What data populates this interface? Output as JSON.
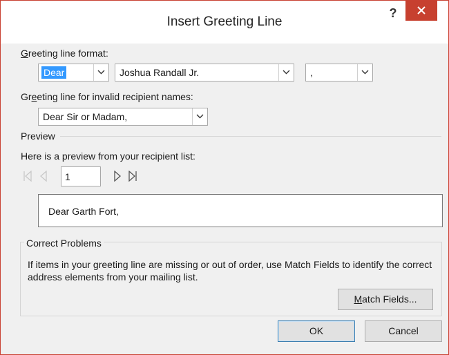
{
  "window": {
    "title": "Insert Greeting Line",
    "help_label": "?"
  },
  "greeting_format": {
    "label_prefix": "G",
    "label_rest": "reeting line format:",
    "salutation": "Dear",
    "name_format": "Joshua Randall Jr.",
    "punctuation": ","
  },
  "invalid_names": {
    "label_prefix": "Gr",
    "label_underlined": "e",
    "label_rest": "eting line for invalid recipient names:",
    "value": "Dear Sir or Madam,"
  },
  "preview": {
    "section_label": "Preview",
    "description": "Here is a preview from your recipient list:",
    "record_number": "1",
    "preview_text": "Dear Garth Fort,"
  },
  "correct_problems": {
    "section_label": "Correct Problems",
    "message": "If items in your greeting line are missing or out of order, use Match Fields to identify the correct address elements from your mailing list.",
    "match_fields_prefix": "M",
    "match_fields_rest": "atch Fields..."
  },
  "buttons": {
    "ok": "OK",
    "cancel": "Cancel"
  },
  "colors": {
    "close_button": "#c7402f",
    "selection_highlight": "#3399ff"
  }
}
